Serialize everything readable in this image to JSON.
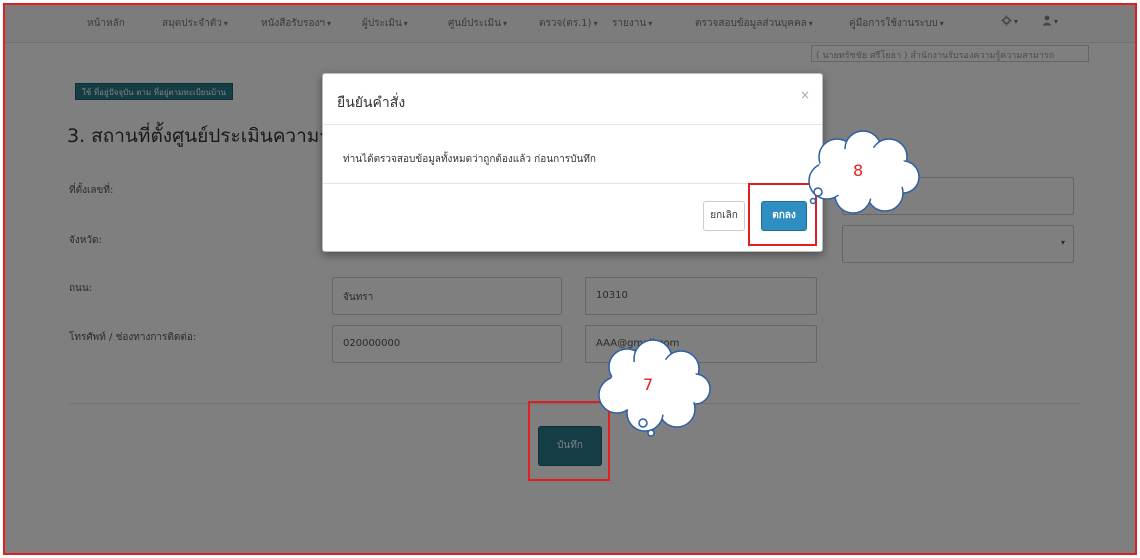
{
  "nav": {
    "items": [
      {
        "label": "หน้าหลัก",
        "dropdown": false
      },
      {
        "label": "สมุดประจำตัว",
        "dropdown": true
      },
      {
        "label": "หนังสือรับรองฯ",
        "dropdown": true
      },
      {
        "label": "ผู้ประเมิน",
        "dropdown": true
      },
      {
        "label": "ศูนย์ประเมิน",
        "dropdown": true
      },
      {
        "label": "ตรวจ(ตร.1)",
        "dropdown": true
      },
      {
        "label": "รายงาน",
        "dropdown": true
      },
      {
        "label": "ตรวจสอบข้อมูลส่วนบุคคล",
        "dropdown": true
      },
      {
        "label": "คู่มือการใช้งานระบบ",
        "dropdown": true
      }
    ],
    "settings_icon": "gear-icon",
    "user_icon": "user-icon",
    "caret": "▾"
  },
  "user_info": "( นายทรัชชัย ศรีโยธา ) สำนักงานรับรองความรู้ความสามารถ",
  "form": {
    "use_address_button": "ใช้ ที่อยู่ปัจจุบัน ตาม ที่อยู่ตามทะเบียนบ้าน",
    "section_title": "3. สถานที่ตั้งศูนย์ประเมินความรู้ความสามารถ",
    "labels": {
      "address_no": "ที่ตั้งเลขที่:",
      "province": "จังหวัด:",
      "road": "ถนน:",
      "phone": "โทรศัพท์ / ช่องทางการติดต่อ:"
    },
    "values": {
      "road": "จันทรา",
      "postcode": "10310",
      "phone": "020000000",
      "email": "AAA@gmail.com"
    },
    "save_button": "บันทึก"
  },
  "modal": {
    "title": "ยืนยันคำสั่ง",
    "close": "×",
    "message": "ท่านได้ตรวจสอบข้อมูลทั้งหมดว่าถูกต้องแล้ว ก่อนการบันทึก",
    "cancel_button": "ยกเลิก",
    "ok_button": "ตกลง"
  },
  "annotations": {
    "step_save": "7",
    "step_ok": "8"
  },
  "colors": {
    "highlight": "#e02020",
    "primary_button": "#2e8ec1",
    "teal_button": "#2a7a8a"
  }
}
